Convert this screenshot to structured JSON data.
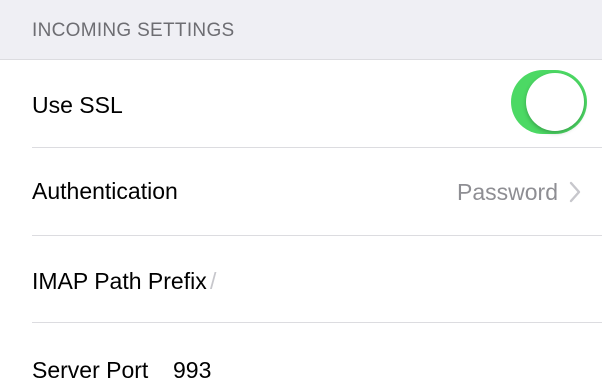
{
  "section": {
    "title": "INCOMING SETTINGS"
  },
  "rows": {
    "use_ssl": {
      "label": "Use SSL",
      "toggle_on": true,
      "toggle_color": "#4cd964"
    },
    "authentication": {
      "label": "Authentication",
      "value": "Password",
      "icon": "chevron-right-icon"
    },
    "imap_path_prefix": {
      "label": "IMAP Path Prefix",
      "value": "/"
    },
    "server_port": {
      "label": "Server Port",
      "value": "993"
    }
  }
}
